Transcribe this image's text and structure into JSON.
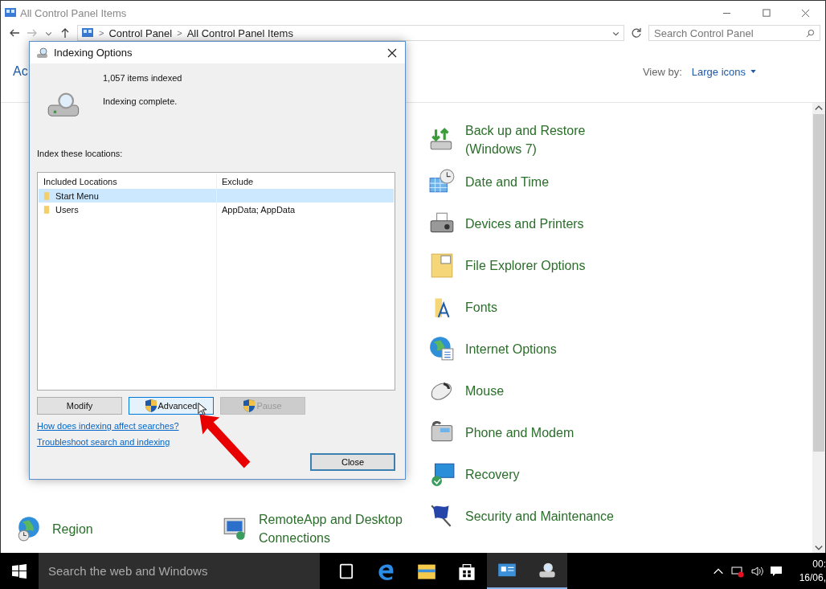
{
  "window": {
    "title": "All Control Panel Items"
  },
  "address_bar": {
    "breadcrumb": [
      "Control Panel",
      "All Control Panel Items"
    ],
    "separators": [
      ">",
      ">"
    ],
    "search": {
      "placeholder": "Search Control Panel"
    }
  },
  "header": {
    "heading": "Ac",
    "view_by_label": "View by:",
    "view_by_value": "Large icons"
  },
  "items": [
    {
      "label": "Back up and Restore (Windows 7)",
      "kind": "backup"
    },
    {
      "label": "Date and Time",
      "kind": "clock"
    },
    {
      "label": "Devices and Printers",
      "kind": "printer"
    },
    {
      "label": "File Explorer Options",
      "kind": "folder"
    },
    {
      "label": "Fonts",
      "kind": "fonts"
    },
    {
      "label": "Internet Options",
      "kind": "globe"
    },
    {
      "label": "Mouse",
      "kind": "mouse"
    },
    {
      "label": "Phone and Modem",
      "kind": "phone"
    },
    {
      "label": "Recovery",
      "kind": "monitor"
    },
    {
      "label": "Security and Maintenance",
      "kind": "flag"
    }
  ],
  "bottom_items": [
    {
      "label": "Region",
      "kind": "globe"
    },
    {
      "label": "RemoteApp and Desktop Connections",
      "kind": "monitor"
    }
  ],
  "dialog": {
    "title": "Indexing Options",
    "items_indexed": "1,057 items indexed",
    "status": "Indexing complete.",
    "locations_label": "Index these locations:",
    "table": {
      "columns": [
        "Included Locations",
        "Exclude"
      ],
      "rows": [
        {
          "location": "Start Menu",
          "exclude": "",
          "selected": true
        },
        {
          "location": "Users",
          "exclude": "AppData; AppData",
          "selected": false
        }
      ]
    },
    "buttons": [
      {
        "label": "Modify",
        "shield": false,
        "disabled": false,
        "hovered": false
      },
      {
        "label": "Advanced",
        "shield": true,
        "disabled": false,
        "hovered": true
      },
      {
        "label": "Pause",
        "shield": true,
        "disabled": true,
        "hovered": false
      }
    ],
    "links": [
      "How does indexing affect searches?",
      "Troubleshoot search and indexing"
    ],
    "close_button": "Close"
  },
  "taskbar": {
    "search": {
      "placeholder": "Search the web and Windows"
    },
    "apps": [
      {
        "kind": "taskview",
        "active": false
      },
      {
        "kind": "edge",
        "active": false
      },
      {
        "kind": "explorer",
        "active": false
      },
      {
        "kind": "store",
        "active": false
      },
      {
        "kind": "controlpanel",
        "active": true
      },
      {
        "kind": "indexing",
        "active": true
      }
    ],
    "time": "00:",
    "date": "16/06,"
  }
}
